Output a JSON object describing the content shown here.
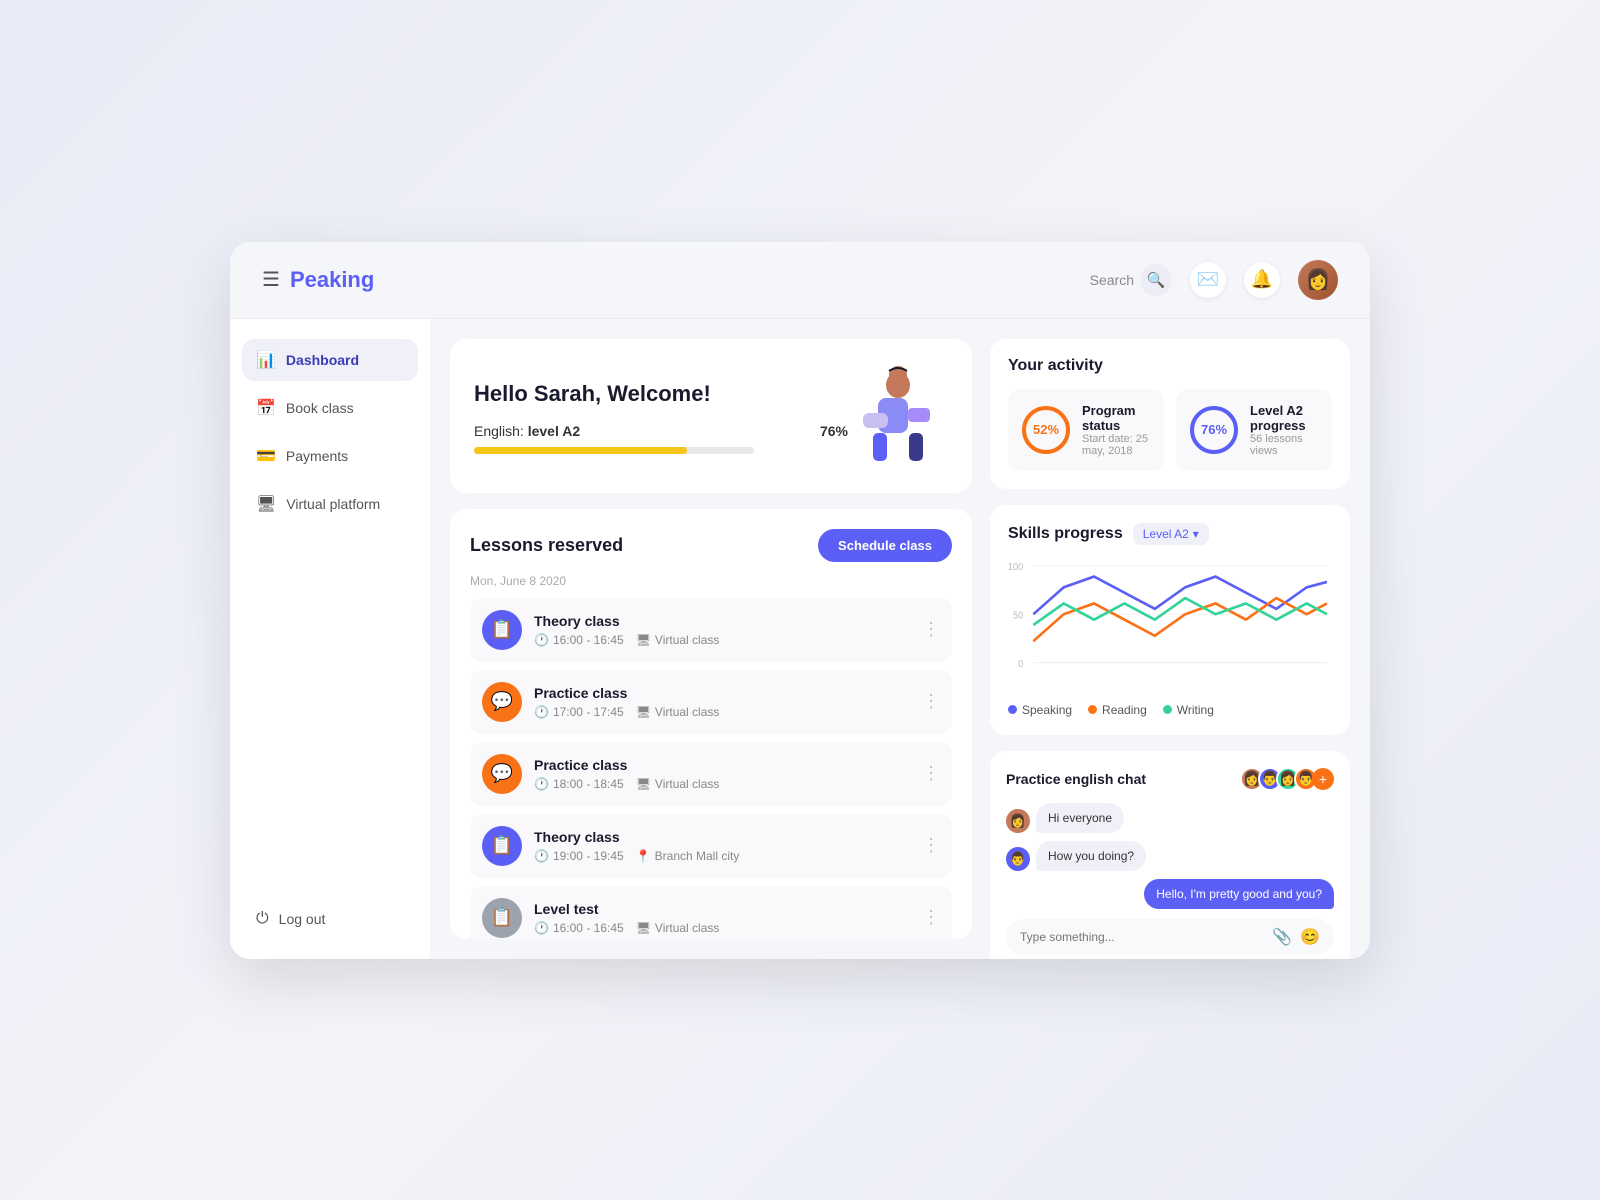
{
  "app": {
    "name": "Peaking",
    "search_placeholder": "Search"
  },
  "nav": {
    "items": [
      {
        "id": "dashboard",
        "label": "Dashboard",
        "icon": "📊",
        "active": true
      },
      {
        "id": "book-class",
        "label": "Book class",
        "icon": "📅"
      },
      {
        "id": "payments",
        "label": "Payments",
        "icon": "💳"
      },
      {
        "id": "virtual-platform",
        "label": "Virtual platform",
        "icon": "🖥"
      }
    ],
    "logout": "Log out"
  },
  "welcome": {
    "greeting": "Hello Sarah, Welcome!",
    "progress_label": "English:",
    "level": "level A2",
    "progress_pct": "76%",
    "progress_value": 76
  },
  "lessons": {
    "title": "Lessons reserved",
    "schedule_btn": "Schedule class",
    "date": "Mon, June 8 2020",
    "items": [
      {
        "name": "Theory class",
        "time": "16:00 - 16:45",
        "location": "Virtual class",
        "type": "theory",
        "color": "purple"
      },
      {
        "name": "Practice class",
        "time": "17:00 - 17:45",
        "location": "Virtual class",
        "type": "practice",
        "color": "orange"
      },
      {
        "name": "Practice class",
        "time": "18:00 - 18:45",
        "location": "Virtual class",
        "type": "practice",
        "color": "orange"
      },
      {
        "name": "Theory class",
        "time": "19:00 - 19:45",
        "location": "Branch Mall city",
        "type": "theory",
        "color": "purple"
      },
      {
        "name": "Level test",
        "time": "16:00 - 16:45",
        "location": "Virtual class",
        "type": "level",
        "color": "gray"
      }
    ]
  },
  "activity": {
    "title": "Your activity",
    "program_status": {
      "pct": "52%",
      "label": "Program status",
      "sub": "Start date: 25 may, 2018",
      "color": "orange"
    },
    "level_progress": {
      "pct": "76%",
      "label": "Level A2 progress",
      "sub": "56 lessons views",
      "color": "purple"
    }
  },
  "skills": {
    "title": "Skills progress",
    "level": "Level A2",
    "y_labels": [
      "100",
      "50",
      "0"
    ],
    "legend": [
      {
        "label": "Speaking",
        "color": "#5b5ff5"
      },
      {
        "label": "Reading",
        "color": "#f97316"
      },
      {
        "label": "Writing",
        "color": "#34d399"
      }
    ]
  },
  "chat": {
    "title": "Practice english chat",
    "messages": [
      {
        "sender": "user1",
        "text": "Hi everyone",
        "type": "received"
      },
      {
        "sender": "user2",
        "text": "How you doing?",
        "type": "received"
      },
      {
        "sender": "me",
        "text": "Hello, I'm pretty good and you?",
        "type": "sent"
      }
    ],
    "input_placeholder": "Type something..."
  }
}
